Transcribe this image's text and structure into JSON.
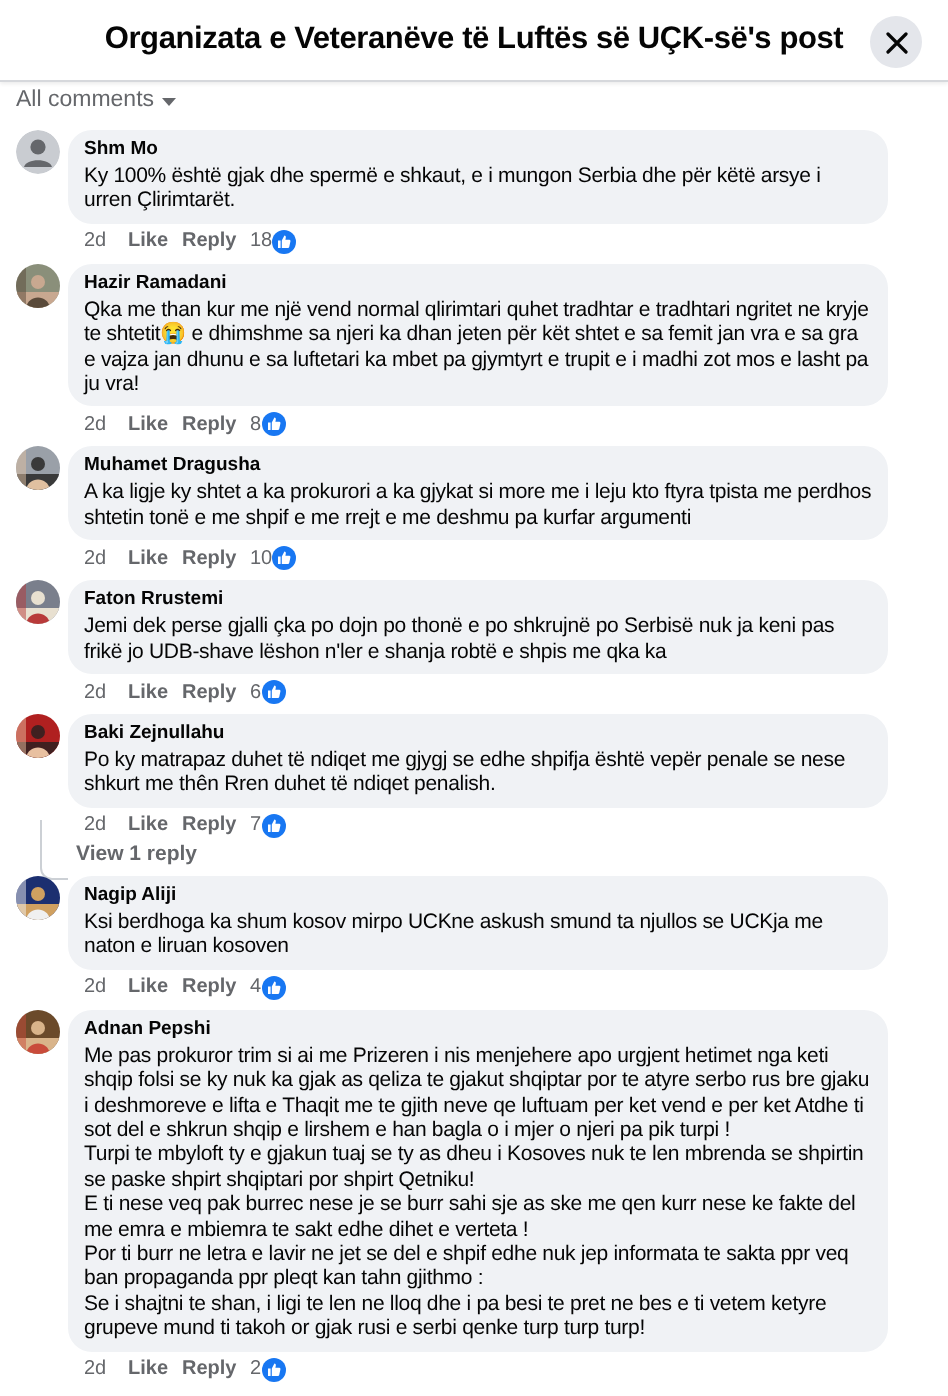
{
  "header": {
    "title": "Organizata e Veteranëve të Luftës së UÇK-së's post"
  },
  "filter": {
    "label": "All comments"
  },
  "comments": [
    {
      "author": "Shm Mo",
      "avatar": {
        "kind": "silhouette"
      },
      "text": "Ky 100% është gjak dhe spermë e shkaut, e i mungon Serbia dhe për këtë arsye i urren Çlirimtarët.",
      "time": "2d",
      "like": "Like",
      "reply": "Reply",
      "reactions": "18"
    },
    {
      "author": "Hazir Ramadani",
      "text": "Qka me than kur me një vend normal qlirimtari quhet tradhtar e tradhtari ngritet ne kryje te shtetit😭 e dhimshme sa njeri ka dhan jeten për kët shtet e sa femit jan vra e sa gra e vajza jan dhunu e sa luftetari ka mbet pa gjymtyrt e trupit e i madhi zot mos e lasht pa ju vra!",
      "time": "2d",
      "like": "Like",
      "reply": "Reply",
      "reactions": "8"
    },
    {
      "author": "Muhamet Dragusha",
      "text": "A ka ligje ky shtet a ka prokurori a ka gjykat si more me i leju kto ftyra tpista me perdhos shtetin tonë e me shpif e me rrejt e me deshmu pa kurfar argumenti",
      "time": "2d",
      "like": "Like",
      "reply": "Reply",
      "reactions": "10"
    },
    {
      "author": "Faton Rrustemi",
      "text": "Jemi dek perse gjalli çka po dojn po thonë e po shkrujnë po Serbisë nuk ja keni pas frikë jo UDB-shave lëshon n'ler e shanja robtë e shpis me qka ka",
      "time": "2d",
      "like": "Like",
      "reply": "Reply",
      "reactions": "6"
    },
    {
      "author": "Baki Zejnullahu",
      "text": "Po ky matrapaz duhet të ndiqet me gjygj se edhe shpifja është vepër penale se nese shkurt me thên Rren duhet të ndiqet penalish.",
      "time": "2d",
      "like": "Like",
      "reply": "Reply",
      "reactions": "7",
      "replies_link": "View 1 reply"
    },
    {
      "author": "Nagip Aliji",
      "text": "Ksi berdhoga ka shum kosov mirpo UCKne askush smund ta njullos se UCKja me naton e liruan kosoven",
      "time": "2d",
      "like": "Like",
      "reply": "Reply",
      "reactions": "4"
    },
    {
      "author": "Adnan Pepshi",
      "text": "Me pas prokuror trim si ai me Prizeren i nis menjehere apo urgjent hetimet nga keti shqip folsi se ky nuk ka gjak as qeliza te gjakut shqiptar por te atyre serbo rus bre gjaku i deshmoreve e lifta e Thaqit me te gjith neve qe luftuam per ket vend e per ket Atdhe ti sot del e shkrun shqip e lirshem e han bagla o i mjer o njeri pa pik turpi !\nTurpi te mbyloft ty e gjakun tuaj se ty as dheu i Kosoves nuk te len mbrenda se shpirtin se paske shpirt shqiptari por shpirt Qetniku!\nE ti nese veq pak burrec nese je se burr sahi sje as ske me qen kurr nese ke fakte del me emra e mbiemra te sakt edhe dihet e verteta !\nPor ti burr ne letra e lavir ne jet se del e shpif edhe nuk jep informata te sakta ppr veq ban propaganda ppr pleqt kan tahn gjithmo :\nSe i shajtni te shan, i ligi te len ne lloq dhe i pa besi te pret ne bes e ti vetem ketyre grupeve mund ti takoh or gjak rusi e serbi qenke turp turp turp!",
      "time": "2d",
      "like": "Like",
      "reply": "Reply",
      "reactions": "2"
    }
  ]
}
